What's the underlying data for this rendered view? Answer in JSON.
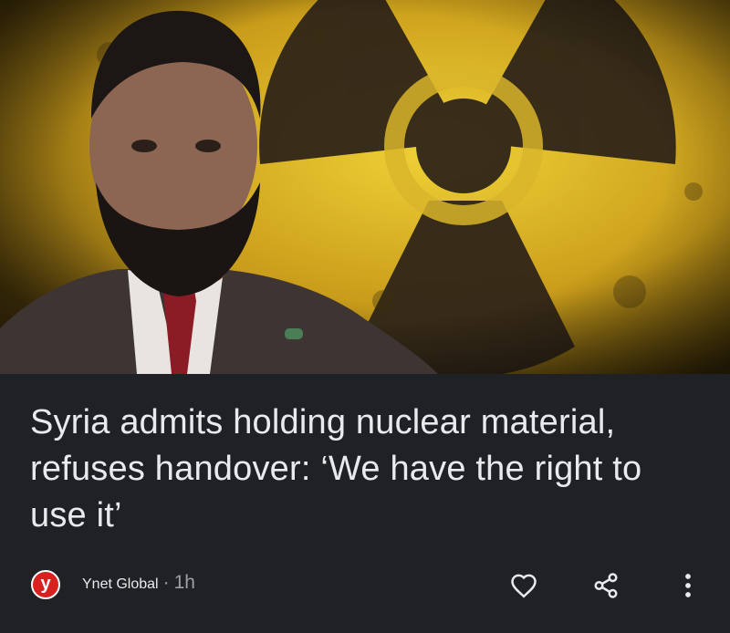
{
  "article": {
    "image_description": "photo",
    "headline": "Syria admits holding nuclear material, refuses handover: ‘We have the right to use it’"
  },
  "source": {
    "logo_letter": "y",
    "name": "Ynet Global",
    "separator": "·",
    "time": "1h",
    "logo_color": "#d7211f"
  },
  "actions": {
    "like_icon": "heart-icon",
    "share_icon": "share-icon",
    "more_icon": "more-vertical-icon"
  },
  "colors": {
    "background": "#202124",
    "text": "#e8eaed",
    "muted": "#9aa0a6"
  }
}
